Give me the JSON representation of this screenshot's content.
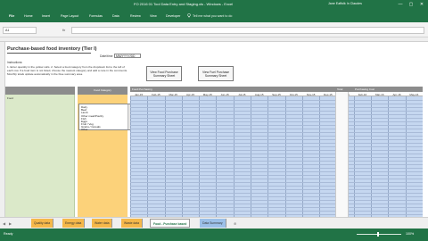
{
  "window": {
    "title": "FO 2016 01 Tool Data Entry and Staging.xls - Windows - Excel",
    "user": "Jane Eaffolk In Claudes",
    "controls": [
      "—",
      "▢",
      "✕"
    ]
  },
  "ribbon": {
    "tabs": [
      "File",
      "Home",
      "Insert",
      "Page Layout",
      "Formulas",
      "Data",
      "Review",
      "View",
      "Developer"
    ],
    "tell_me": "Tell me what you want to do"
  },
  "formula_bar": {
    "name_box": "A1",
    "fx": "fx",
    "content": ""
  },
  "sheet": {
    "title": "Purchase-based food inventory (Tier I)",
    "date_label": "Date/time",
    "date_value": "MM/YYYY/DD",
    "instructions_label": "Instructions:",
    "instructions_text": "1. Enter quantity in the yellow cells. 2. Select a food category from the dropdown list to the left of each row. If a food item is not listed, choose the nearest category and add a note in the comments. Monthly totals update automatically in the blue summary area.",
    "button_1": "View Food Purchase Summary Sheet",
    "button_2": "View Fuel Purchase Summary Sheet",
    "left_items": [
      "Food"
    ],
    "list_header": "Food Category",
    "dropdown_options": [
      "Dairy",
      "Beef",
      "Lamb",
      "Other meat/Poultry",
      "Fish",
      "Eggs",
      "Fruit / Veg",
      "Grains / Cereals",
      "Other"
    ],
    "blue_caption": "Food Purchasing",
    "blue_caption_2": "Total",
    "blue_caption_3": "Purchasing Cost",
    "months": [
      "Jan-15",
      "Feb-15",
      "Mar-15",
      "Apr-15",
      "May-15",
      "Jun-15",
      "Jul-15",
      "Aug-15",
      "Sep-15",
      "Oct-15",
      "Nov-15",
      "Dec-15",
      "Jan-16",
      "Feb-16",
      "Mar-16",
      "Apr-16",
      "May-16"
    ]
  },
  "sheet_tabs": [
    "Quality data",
    "Energy data",
    "Water data",
    "Waste data",
    "Food - Purchase based",
    "Data Summary"
  ],
  "active_tab": "Food - Purchase based",
  "status": {
    "ready": "Ready",
    "zoom": "100%"
  },
  "colors": {
    "excel_green": "#217346",
    "left_panel": "#dbe9c9",
    "orange_panel": "#fcd27a",
    "blue_grid": "#c5d7f0",
    "header_gray": "#8c8c8c"
  }
}
